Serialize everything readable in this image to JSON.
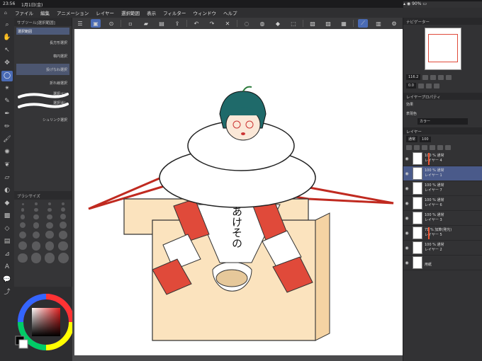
{
  "status": {
    "time": "23:56",
    "date": "1月1日(金)",
    "battery": "90%"
  },
  "menu": [
    "ファイル",
    "編集",
    "アニメーション",
    "レイヤー",
    "選択範囲",
    "表示",
    "フィルター",
    "ウィンドウ",
    "ヘルプ"
  ],
  "subtool": {
    "header": "サブツール[選択範囲]",
    "tab": "選択範囲",
    "items": [
      "長方形選択",
      "楕円選択",
      "投げなわ選択",
      "折れ線選択",
      "選択ペン",
      "選択消し",
      "シュリンク選択"
    ]
  },
  "brushsize": {
    "header": "ブラシサイズ",
    "sizes": [
      "0.7",
      "1",
      "1.5",
      "2",
      "2.5",
      "3",
      "4",
      "5",
      "6",
      "7",
      "8",
      "10",
      "12",
      "15",
      "17",
      "20",
      "25",
      "30",
      "40",
      "50",
      "60",
      "70",
      "80",
      "100",
      "120",
      "150",
      "170",
      "200"
    ]
  },
  "navigator": {
    "header": "ナビゲーター",
    "zoom": "116.2",
    "angle": "0.0"
  },
  "layer_property": {
    "header": "レイヤープロパティ",
    "effect_label": "効果",
    "color_label": "表現色",
    "color_value": "カラー"
  },
  "layers_panel": {
    "header": "レイヤー",
    "blend": "通常",
    "opacity": "100",
    "layers": [
      {
        "pct": "100 %",
        "mode": "通常",
        "name": "レイヤー 4"
      },
      {
        "pct": "100 %",
        "mode": "通常",
        "name": "レイヤー 1"
      },
      {
        "pct": "100 %",
        "mode": "通常",
        "name": "レイヤー 7"
      },
      {
        "pct": "100 %",
        "mode": "通常",
        "name": "レイヤー 6"
      },
      {
        "pct": "100 %",
        "mode": "通常",
        "name": "レイヤー 3"
      },
      {
        "pct": "71 %",
        "mode": "加算(発光)",
        "name": "レイヤー 5"
      },
      {
        "pct": "100 %",
        "mode": "通常",
        "name": "レイヤー 2"
      },
      {
        "pct": "",
        "mode": "",
        "name": "用紙"
      }
    ]
  },
  "canvas_text": "あけその",
  "colors": {
    "accent": "#4a6bb5",
    "red": "#e04a3a",
    "box": "#fbe3be",
    "hair": "#1f6a6a"
  }
}
